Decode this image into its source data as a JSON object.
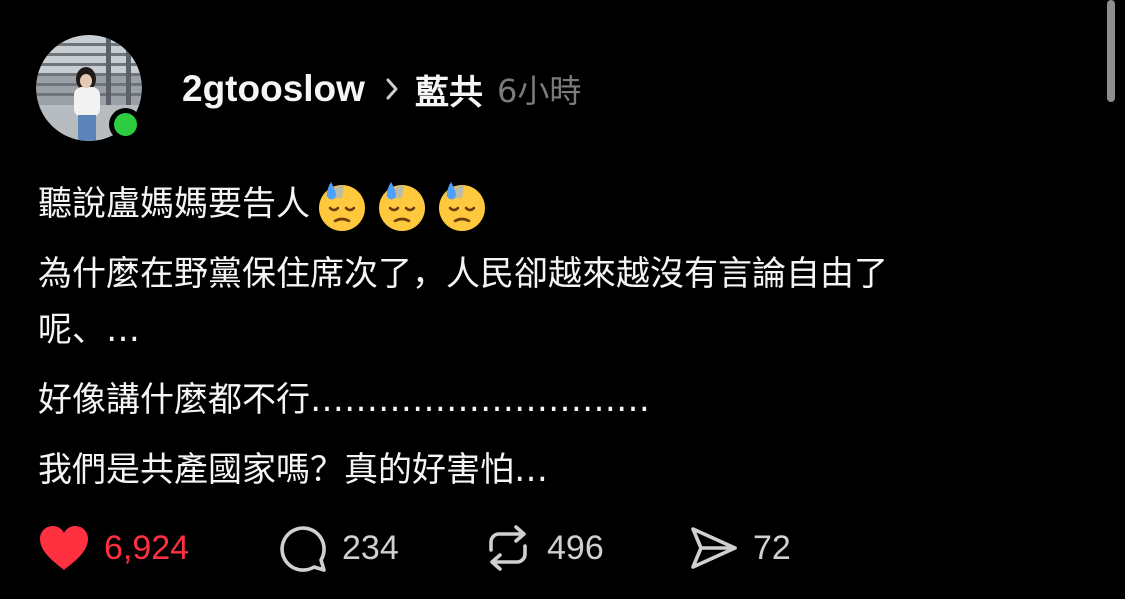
{
  "post": {
    "username": "2gtooslow",
    "topic": "藍共",
    "time": "6小時",
    "lines": [
      "聽說盧媽媽要告人",
      "為什麼在野黨保住席次了，人民卻越來越沒有言論自由了",
      "呢、…",
      "好像講什麼都不行…………………………",
      "我們是共產國家嗎？真的好害怕…"
    ],
    "emoji_name": "downcast-face-with-sweat",
    "emoji_count": 3
  },
  "actions": {
    "likes": "6,924",
    "comments": "234",
    "reposts": "496",
    "shares": "72"
  },
  "colors": {
    "background": "#000000",
    "text": "#f3f5f7",
    "muted": "#7b7b7b",
    "like": "#ff3040",
    "online": "#2ecc40"
  }
}
